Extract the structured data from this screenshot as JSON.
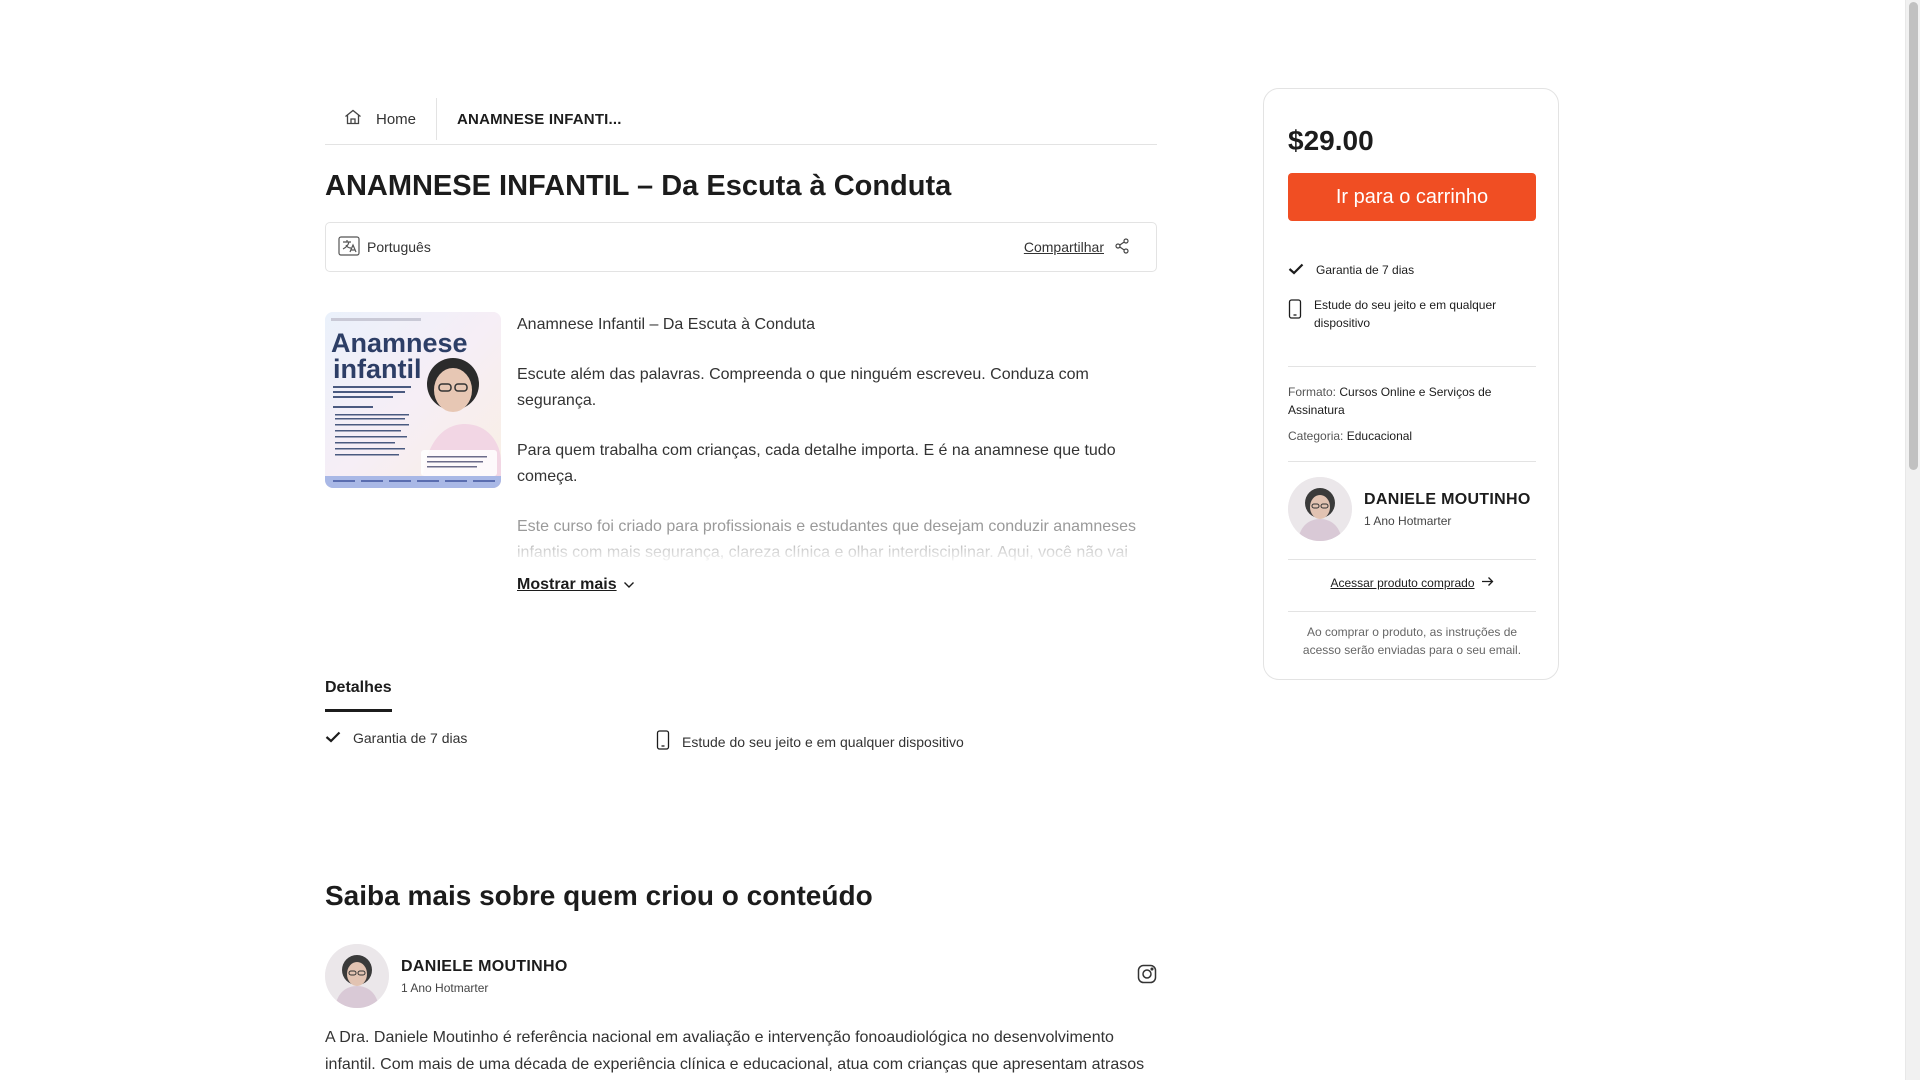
{
  "breadcrumb": {
    "home": "Home",
    "current": "ANAMNESE INFANTI..."
  },
  "product": {
    "title": "ANAMNESE INFANTIL – Da Escuta à Conduta",
    "language": "Português",
    "share": "Compartilhar",
    "image_text": {
      "heading_line1": "Anamnese",
      "heading_line2": "infantil"
    },
    "description": [
      "Anamnese Infantil – Da Escuta à Conduta",
      "Escute além das palavras. Compreenda o que ninguém escreveu. Conduza com segurança.",
      "Para quem trabalha com crianças, cada detalhe importa. E é na anamnese que tudo começa.",
      "Este curso foi criado para profissionais e estudantes que desejam conduzir anamneses infantis com mais segurança, clareza clínica e olhar interdisciplinar. Aqui, você não vai"
    ],
    "show_more": "Mostrar mais"
  },
  "details": {
    "tab": "Detalhes",
    "features": [
      {
        "icon": "check-icon",
        "text": "Garantia de 7 dias"
      },
      {
        "icon": "smartphone-icon",
        "text": "Estude do seu jeito e em qualquer dispositivo"
      }
    ]
  },
  "creator_section": {
    "heading": "Saiba mais sobre quem criou o conteúdo",
    "name": "DANIELE MOUTINHO",
    "subtitle": "1 Ano Hotmarter",
    "social_icon": "instagram-icon",
    "bio": "A Dra. Daniele Moutinho é referência nacional em avaliação e intervenção fonoaudiológica no desenvolvimento infantil. Com mais de uma década de experiência clínica e educacional, atua com crianças que apresentam atrasos"
  },
  "purchase_panel": {
    "price": "$29.00",
    "cart_button": "Ir para o carrinho",
    "features": [
      {
        "icon": "check-icon",
        "text": "Garantia de 7 dias"
      },
      {
        "icon": "smartphone-icon",
        "text": "Estude do seu jeito e em qualquer dispositivo"
      }
    ],
    "format_label": "Formato:",
    "format_value": "Cursos Online e Serviços de Assinatura",
    "category_label": "Categoria:",
    "category_value": "Educacional",
    "creator_name": "DANIELE MOUTINHO",
    "creator_subtitle": "1 Ano Hotmarter",
    "access_link": "Acessar produto comprado",
    "note": "Ao comprar o produto, as instruções de acesso serão enviadas para o seu email."
  },
  "colors": {
    "accent": "#f04e23",
    "text": "#1c1c1c",
    "border": "#e3e3e3"
  }
}
